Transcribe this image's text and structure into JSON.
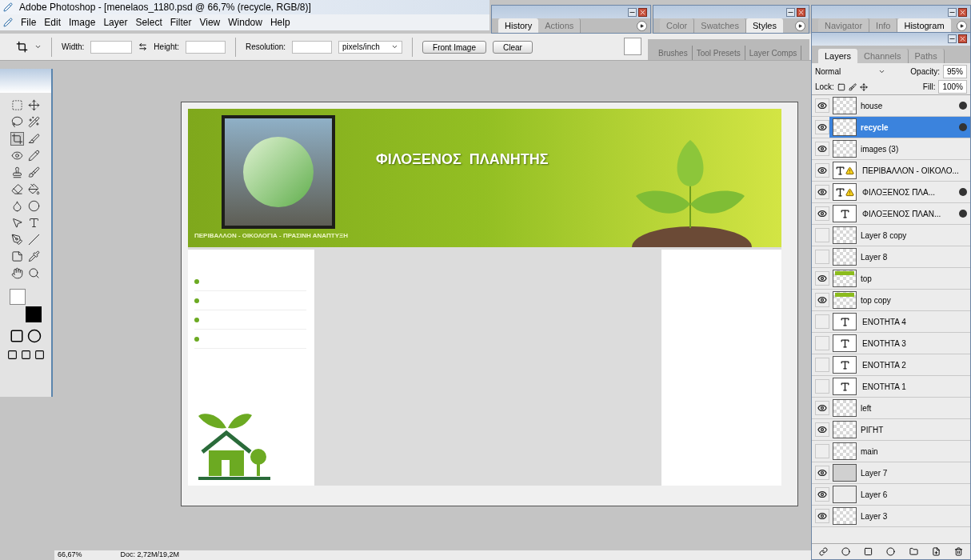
{
  "window": {
    "title": "Adobe Photoshop - [menelaos_1180.psd @ 66,7% (recycle, RGB/8)]"
  },
  "menu": [
    "File",
    "Edit",
    "Image",
    "Layer",
    "Select",
    "Filter",
    "View",
    "Window",
    "Help"
  ],
  "options_bar": {
    "width_label": "Width:",
    "height_label": "Height:",
    "resolution_label": "Resolution:",
    "units": "pixels/inch",
    "buttons": [
      "Front Image",
      "Clear"
    ]
  },
  "panel_wells": [
    {
      "tabs": [
        {
          "label": "History",
          "selected": true
        },
        {
          "label": "Actions",
          "selected": false
        }
      ]
    },
    {
      "tabs": [
        {
          "label": "Color",
          "selected": false
        },
        {
          "label": "Swatches",
          "selected": false
        },
        {
          "label": "Styles",
          "selected": true
        }
      ]
    }
  ],
  "palette_well": {
    "tabs": [
      "Brushes",
      "Tool Presets",
      "Layer Comps"
    ]
  },
  "navigator_panel": {
    "tabs": [
      {
        "label": "Navigator",
        "selected": false
      },
      {
        "label": "Info",
        "selected": false
      },
      {
        "label": "Histogram",
        "selected": true
      }
    ]
  },
  "layers_panel": {
    "tabs": [
      {
        "label": "Layers",
        "selected": true
      },
      {
        "label": "Channels",
        "selected": false
      },
      {
        "label": "Paths",
        "selected": false
      }
    ],
    "blend_mode": "Normal",
    "opacity_label": "Opacity:",
    "opacity": "95%",
    "lock_label": "Lock:",
    "fill_label": "Fill:",
    "fill": "100%",
    "layers": [
      {
        "name": "house",
        "kind": "pixel",
        "thumbnail": {
          "kind": "checker"
        },
        "visible": true,
        "selected": false,
        "effects": true,
        "warning": false
      },
      {
        "name": "recycle",
        "kind": "pixel",
        "thumbnail": {
          "kind": "checker"
        },
        "visible": true,
        "selected": true,
        "effects": true,
        "warning": false
      },
      {
        "name": "images (3)",
        "kind": "pixel",
        "thumbnail": {
          "kind": "checker"
        },
        "visible": true,
        "selected": false,
        "effects": false,
        "warning": false
      },
      {
        "name": "ΠΕΡΙΒΑΛΛΟΝ - ΟΙΚΟΛΟ...",
        "kind": "text",
        "thumbnail": {
          "kind": "white"
        },
        "visible": true,
        "selected": false,
        "effects": false,
        "warning": true
      },
      {
        "name": "ΦΙΛΟΞΕΝΟΣ  ΠΛΑ...",
        "kind": "text",
        "thumbnail": {
          "kind": "white"
        },
        "visible": true,
        "selected": false,
        "effects": true,
        "warning": true
      },
      {
        "name": "ΦΙΛΟΞΕΝΟΣ ΠΛΑΝ...",
        "kind": "text",
        "thumbnail": {
          "kind": "white"
        },
        "visible": true,
        "selected": false,
        "effects": true,
        "warning": false
      },
      {
        "name": "Layer 8 copy",
        "kind": "pixel",
        "thumbnail": {
          "kind": "checker"
        },
        "visible": false,
        "selected": false,
        "effects": false,
        "warning": false
      },
      {
        "name": "Layer 8",
        "kind": "pixel",
        "thumbnail": {
          "kind": "checker"
        },
        "visible": false,
        "selected": false,
        "effects": false,
        "warning": false
      },
      {
        "name": "top",
        "kind": "pixel",
        "thumbnail": {
          "kind": "green"
        },
        "visible": true,
        "selected": false,
        "effects": false,
        "warning": false
      },
      {
        "name": "top copy",
        "kind": "pixel",
        "thumbnail": {
          "kind": "green"
        },
        "visible": true,
        "selected": false,
        "effects": false,
        "warning": false
      },
      {
        "name": "ΕΝΟΤΗΤΑ 4",
        "kind": "text",
        "thumbnail": {
          "kind": "white"
        },
        "visible": false,
        "selected": false,
        "effects": false,
        "warning": false
      },
      {
        "name": "ΕΝΟΤΗΤΑ 3",
        "kind": "text",
        "thumbnail": {
          "kind": "white"
        },
        "visible": false,
        "selected": false,
        "effects": false,
        "warning": false
      },
      {
        "name": "ΕΝΟΤΗΤΑ 2",
        "kind": "text",
        "thumbnail": {
          "kind": "white"
        },
        "visible": false,
        "selected": false,
        "effects": false,
        "warning": false
      },
      {
        "name": "ΕΝΟΤΗΤΑ 1",
        "kind": "text",
        "thumbnail": {
          "kind": "white"
        },
        "visible": false,
        "selected": false,
        "effects": false,
        "warning": false
      },
      {
        "name": "left",
        "kind": "pixel",
        "thumbnail": {
          "kind": "checker"
        },
        "visible": true,
        "selected": false,
        "effects": false,
        "warning": false
      },
      {
        "name": "ΡΙΓΗΤ",
        "kind": "pixel",
        "thumbnail": {
          "kind": "checker"
        },
        "visible": true,
        "selected": false,
        "effects": false,
        "warning": false
      },
      {
        "name": "main",
        "kind": "pixel",
        "thumbnail": {
          "kind": "checker"
        },
        "visible": false,
        "selected": false,
        "effects": false,
        "warning": false
      },
      {
        "name": "Layer 7",
        "kind": "pixel",
        "thumbnail": {
          "kind": "gray"
        },
        "visible": true,
        "selected": false,
        "effects": false,
        "warning": false
      },
      {
        "name": "Layer 6",
        "kind": "pixel",
        "thumbnail": {
          "kind": "light"
        },
        "visible": true,
        "selected": false,
        "effects": false,
        "warning": false
      },
      {
        "name": "Layer 3",
        "kind": "pixel",
        "thumbnail": {
          "kind": "checker"
        },
        "visible": true,
        "selected": false,
        "effects": false,
        "warning": false
      }
    ]
  },
  "canvas": {
    "banner_title": "ΦΙΛΟΞΕΝΟΣ  ΠΛΑΝΗΤΗΣ",
    "banner_subtitle": "ΠΕΡΙΒΑΛΛΟΝ - ΟΙΚΟΛΟΓΙΑ - ΠΡΑΣΙΝΗ ΑΝΑΠΤΥΞΗ"
  },
  "status_bar": {
    "zoom": "66,67%",
    "doc": "Doc: 2,72M/19,2M"
  }
}
